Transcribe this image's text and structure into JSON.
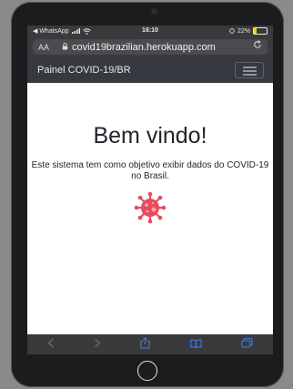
{
  "status_bar": {
    "back_app": "◀ WhatsApp",
    "time": "16:10",
    "battery": "22%",
    "battery_level": 0.22
  },
  "browser": {
    "aa_label": "AA",
    "url": "covid19brazilian.herokuapp.com"
  },
  "navbar": {
    "brand": "Painel COVID-19/BR"
  },
  "main": {
    "title": "Bem vindo!",
    "description": "Este sistema tem como objetivo exibir dados do COVID-19 no Brasil."
  },
  "icons": {
    "virus": "virus-icon",
    "lock": "lock-icon",
    "reload": "reload-icon",
    "menu": "hamburger-icon"
  },
  "colors": {
    "navbar_bg": "#343a40",
    "virus": "#e84a5f",
    "browser_chrome": "#3a3a3c"
  }
}
